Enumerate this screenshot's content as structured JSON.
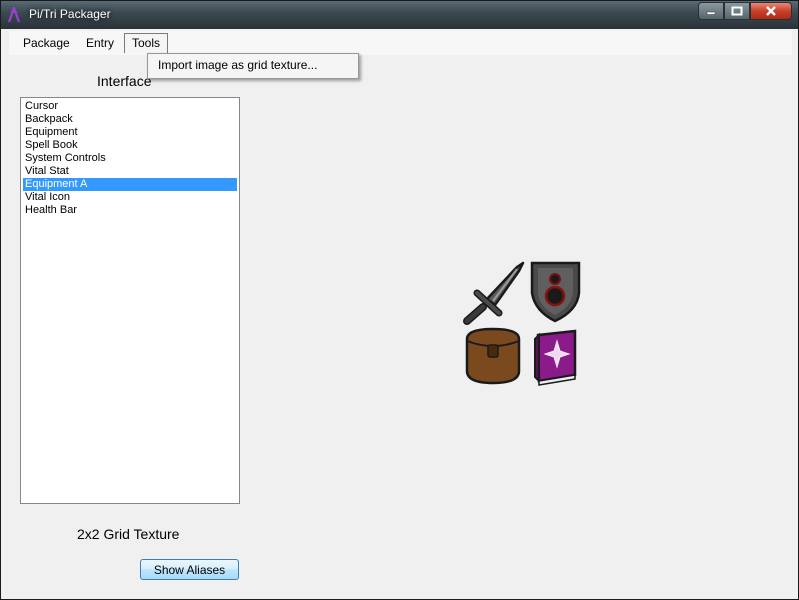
{
  "window": {
    "title": "Pi/Tri Packager"
  },
  "menubar": {
    "items": [
      {
        "label": "Package"
      },
      {
        "label": "Entry"
      },
      {
        "label": "Tools"
      }
    ],
    "dropdown": {
      "items": [
        {
          "label": "Import image as grid texture..."
        }
      ]
    }
  },
  "left_panel": {
    "heading": "Interface",
    "list": [
      {
        "label": "Cursor"
      },
      {
        "label": "Backpack"
      },
      {
        "label": "Equipment"
      },
      {
        "label": "Spell Book"
      },
      {
        "label": "System Controls"
      },
      {
        "label": "Vital Stat"
      },
      {
        "label": "Equipment A",
        "selected": true
      },
      {
        "label": "Vital Icon"
      },
      {
        "label": "Health Bar"
      }
    ],
    "texture_label": "2x2 Grid Texture",
    "show_aliases_label": "Show Aliases"
  },
  "preview": {
    "icons": [
      "sword-icon",
      "shield-icon",
      "backpack-icon",
      "spell-book-icon"
    ]
  },
  "colors": {
    "selection": "#3399ff",
    "book": "#8b1a8b",
    "backpack": "#7a4a1e",
    "shield": "#4a4a4a"
  }
}
